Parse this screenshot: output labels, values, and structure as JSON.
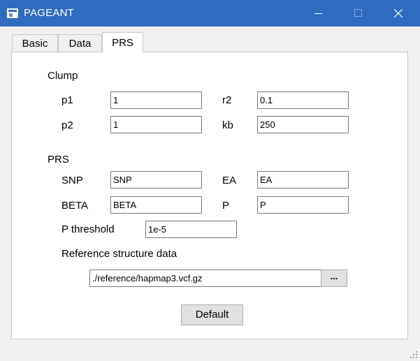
{
  "window": {
    "title": "PAGEANT"
  },
  "tabs": [
    {
      "label": "Basic"
    },
    {
      "label": "Data"
    },
    {
      "label": "PRS"
    }
  ],
  "clump": {
    "heading": "Clump",
    "p1": {
      "label": "p1",
      "value": "1"
    },
    "r2": {
      "label": "r2",
      "value": "0.1"
    },
    "p2": {
      "label": "p2",
      "value": "1"
    },
    "kb": {
      "label": "kb",
      "value": "250"
    }
  },
  "prs": {
    "heading": "PRS",
    "snp": {
      "label": "SNP",
      "value": "SNP"
    },
    "ea": {
      "label": "EA",
      "value": "EA"
    },
    "beta": {
      "label": "BETA",
      "value": "BETA"
    },
    "p": {
      "label": "P",
      "value": "P"
    },
    "p_threshold": {
      "label": "P threshold",
      "value": "1e-5"
    }
  },
  "reference": {
    "label": "Reference structure data",
    "path": "./reference/hapmap3.vcf.gz",
    "browse_label": "..."
  },
  "default_button": "Default",
  "icons": {
    "app": "app-window-icon",
    "minimize": "minimize-icon",
    "maximize": "maximize-icon",
    "close": "close-icon"
  }
}
